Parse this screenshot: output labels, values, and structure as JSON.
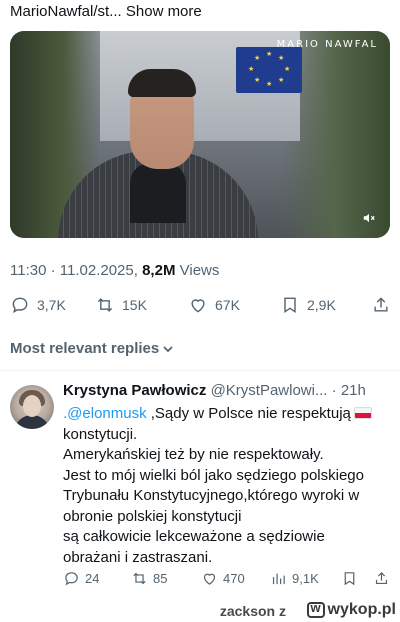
{
  "post": {
    "author_text": "MarioNawfal/st...",
    "show_more": "Show more",
    "video_watermark": "MARIO NAWFAL",
    "time": "11:30",
    "separator": "·",
    "date": "11.02.2025",
    "views_count": "8,2M",
    "views_label": "Views",
    "actions": {
      "replies": "3,7K",
      "reposts": "15K",
      "likes": "67K",
      "bookmarks": "2,9K"
    }
  },
  "replies_sort": {
    "label": "Most relevant replies"
  },
  "reply": {
    "name": "Krystyna Pawłowicz",
    "handle": "@KrystPawlowi...",
    "separator": "·",
    "time": "21h",
    "mention": ".@elonmusk",
    "text_lines": [
      " ,Sądy w Polsce nie respektują",
      "konstytucji.",
      "Amerykańskiej też by nie respektowały.",
      "Jest to mój wielki ból jako sędziego polskiego",
      "Trybunału Konstytucyjnego,którego wyroki w",
      "obronie polskiej konstytucji",
      "są całkowicie lekceważone a sędziowie",
      "obrażani i zastraszani."
    ],
    "actions": {
      "replies": "24",
      "reposts": "85",
      "likes": "470",
      "views": "9,1K"
    }
  },
  "footer": {
    "user": "zackson z",
    "site": "wykop.pl"
  },
  "colors": {
    "link": "#1d9bf0",
    "secondary_text": "#536471",
    "primary_text": "#0f1419"
  }
}
